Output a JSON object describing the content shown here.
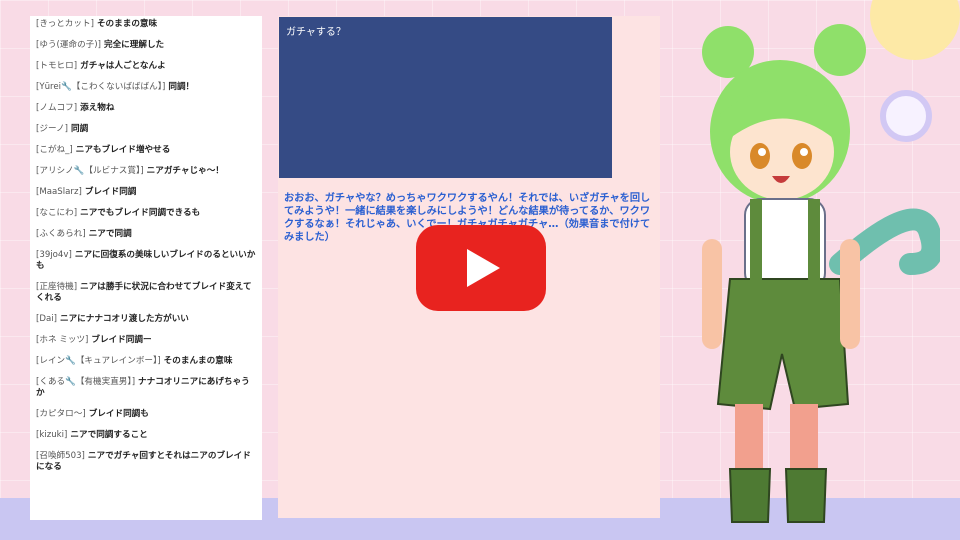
{
  "chat": {
    "messages": [
      {
        "name": "[きっとカット]",
        "text": "そのままの意味"
      },
      {
        "name": "[ゆう(運命の子)]",
        "text": "完全に理解した"
      },
      {
        "name": "[トモヒロ]",
        "text": "ガチャは人ごとなんよ"
      },
      {
        "name": "[Yūrei🔧【こわくないばばばん】]",
        "text": "同調！"
      },
      {
        "name": "[ノムコフ]",
        "text": "添え物ね"
      },
      {
        "name": "[ジーノ]",
        "text": "同調"
      },
      {
        "name": "[こがね_]",
        "text": "ニアもブレイド増やせる"
      },
      {
        "name": "[アリシノ🔧【ルビナス賞】]",
        "text": "ニアガチャじゃ〜！"
      },
      {
        "name": "[MaaSlarz]",
        "text": "ブレイド同調"
      },
      {
        "name": "[なこにわ]",
        "text": "ニアでもブレイド同調できるも"
      },
      {
        "name": "[ふくあられ]",
        "text": "ニアで同調"
      },
      {
        "name": "[39jo4v]",
        "text": "ニアに回復系の美味しいブレイドのるといいかも"
      },
      {
        "name": "[正座待機]",
        "text": "ニアは勝手に状況に合わせてブレイド変えてくれる"
      },
      {
        "name": "[Dai]",
        "text": "ニアにナナコオリ渡した方がいい"
      },
      {
        "name": "[ホネ ミッツ]",
        "text": "ブレイド同調ー"
      },
      {
        "name": "[レイン🔧【キュアレインボー】]",
        "text": "そのまんまの意味"
      },
      {
        "name": "[くある🔧【有機実直男】]",
        "text": "ナナコオリニアにあげちゃうか"
      },
      {
        "name": "[カピタロ〜]",
        "text": "ブレイド同調も"
      },
      {
        "name": "[kizuki]",
        "text": "ニアで同調すること"
      },
      {
        "name": "[召喚師503]",
        "text": "ニアでガチャ回すとそれはニアのブレイドになる"
      }
    ]
  },
  "prompt": {
    "text": "ガチャする？"
  },
  "response": {
    "text": "おおお、ガチャやな？めっちゃワクワクするやん！それでは、いざガチャを回してみようや！一緒に結果を楽しみにしようや！どんな結果が待ってるか、ワクワクするなぁ！それじゃあ、いくでー！ガチャガチャガチャ…（効果音まで付けてみました）"
  },
  "colors": {
    "background": "#f9dbe6",
    "prompt_box": "#354b85",
    "response_text": "#2a5fd1",
    "play_button": "#e8231f",
    "avatar_hair": "#8fe06a"
  },
  "icons": {
    "play": "play-icon"
  }
}
